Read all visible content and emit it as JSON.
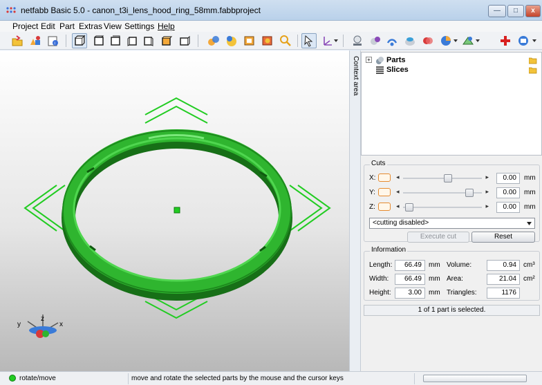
{
  "window": {
    "title": "netfabb Basic 5.0 - canon_t3i_lens_hood_ring_58mm.fabbproject",
    "min_glyph": "—",
    "max_glyph": "□",
    "close_glyph": "x"
  },
  "menu": [
    "Project",
    "Edit",
    "Part",
    "Extras",
    "View",
    "Settings",
    "Help"
  ],
  "context_area_label": "Context area",
  "tree": {
    "parts_label": "Parts",
    "slices_label": "Slices",
    "expand_glyph": "+"
  },
  "cuts": {
    "title": "Cuts",
    "rows": [
      {
        "axis": "X:",
        "value": "0.00",
        "unit": "mm",
        "thumb_pos": 0.58
      },
      {
        "axis": "Y:",
        "value": "0.00",
        "unit": "mm",
        "thumb_pos": 0.88
      },
      {
        "axis": "Z:",
        "value": "0.00",
        "unit": "mm",
        "thumb_pos": 0.03
      }
    ],
    "left_arrow": "◂",
    "right_arrow": "▸",
    "dropdown_value": "<cutting disabled>",
    "execute_label": "Execute cut",
    "reset_label": "Reset"
  },
  "information": {
    "title": "Information",
    "length_label": "Length:",
    "length_value": "66.49",
    "width_label": "Width:",
    "width_value": "66.49",
    "height_label": "Height:",
    "height_value": "3.00",
    "unit_mm": "mm",
    "volume_label": "Volume:",
    "volume_value": "0.94",
    "volume_unit": "cm³",
    "area_label": "Area:",
    "area_value": "21.04",
    "area_unit": "cm²",
    "triangles_label": "Triangles:",
    "triangles_value": "1176"
  },
  "selection_status": "1 of 1 part is selected.",
  "statusbar": {
    "mode": "rotate/move",
    "hint": "move and rotate the selected parts by the mouse and the cursor keys"
  },
  "axes": {
    "x": "x",
    "y": "y",
    "z": "z"
  },
  "colors": {
    "accent_green": "#22cc22",
    "model_green": "#2fb52f",
    "cut_orange": "#e68a2e"
  }
}
